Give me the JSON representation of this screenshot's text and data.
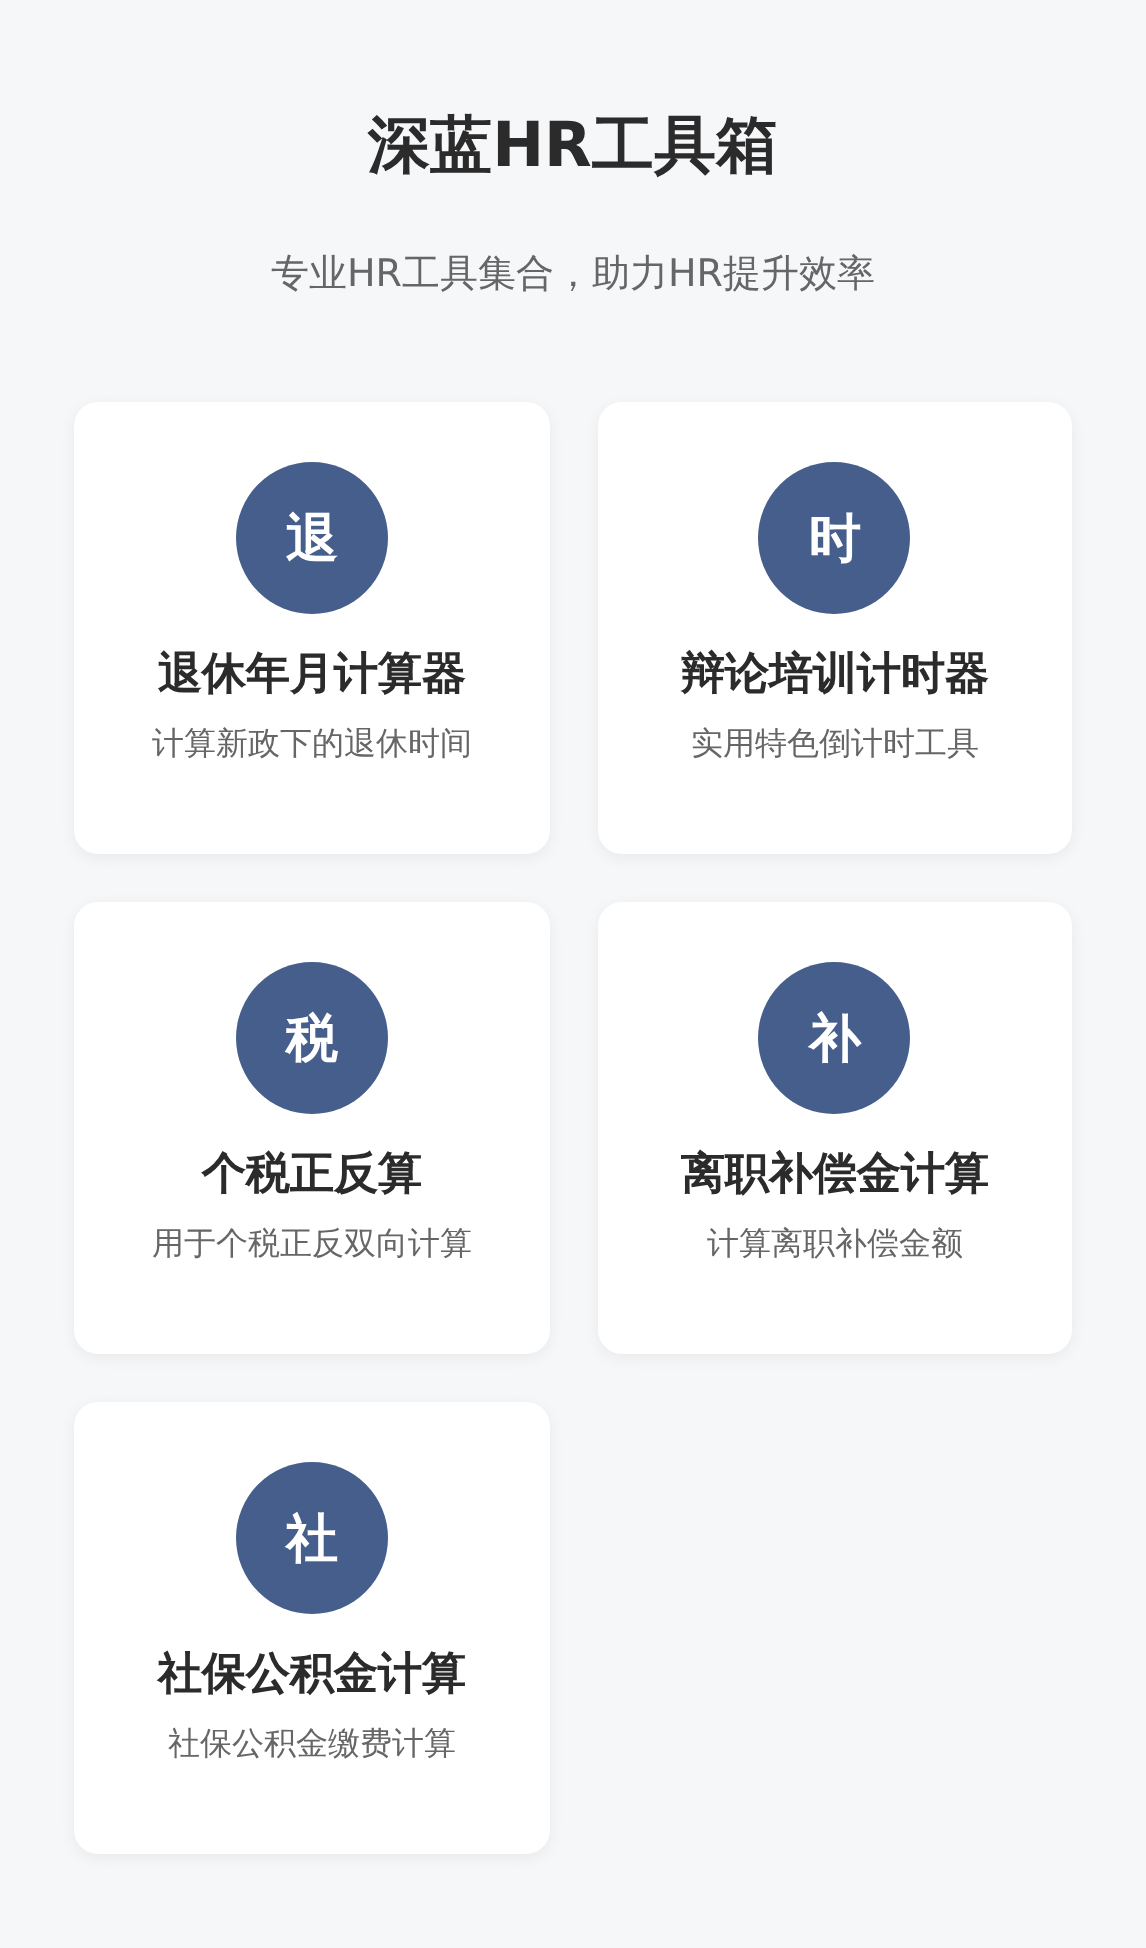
{
  "header": {
    "title": "深蓝HR工具箱",
    "subtitle": "专业HR工具集合，助力HR提升效率"
  },
  "tools": [
    {
      "icon": "退",
      "name": "退休年月计算器",
      "description": "计算新政下的退休时间"
    },
    {
      "icon": "时",
      "name": "辩论培训计时器",
      "description": "实用特色倒计时工具"
    },
    {
      "icon": "税",
      "name": "个税正反算",
      "description": "用于个税正反双向计算"
    },
    {
      "icon": "补",
      "name": "离职补偿金计算",
      "description": "计算离职补偿金额"
    },
    {
      "icon": "社",
      "name": "社保公积金计算",
      "description": "社保公积金缴费计算"
    }
  ]
}
